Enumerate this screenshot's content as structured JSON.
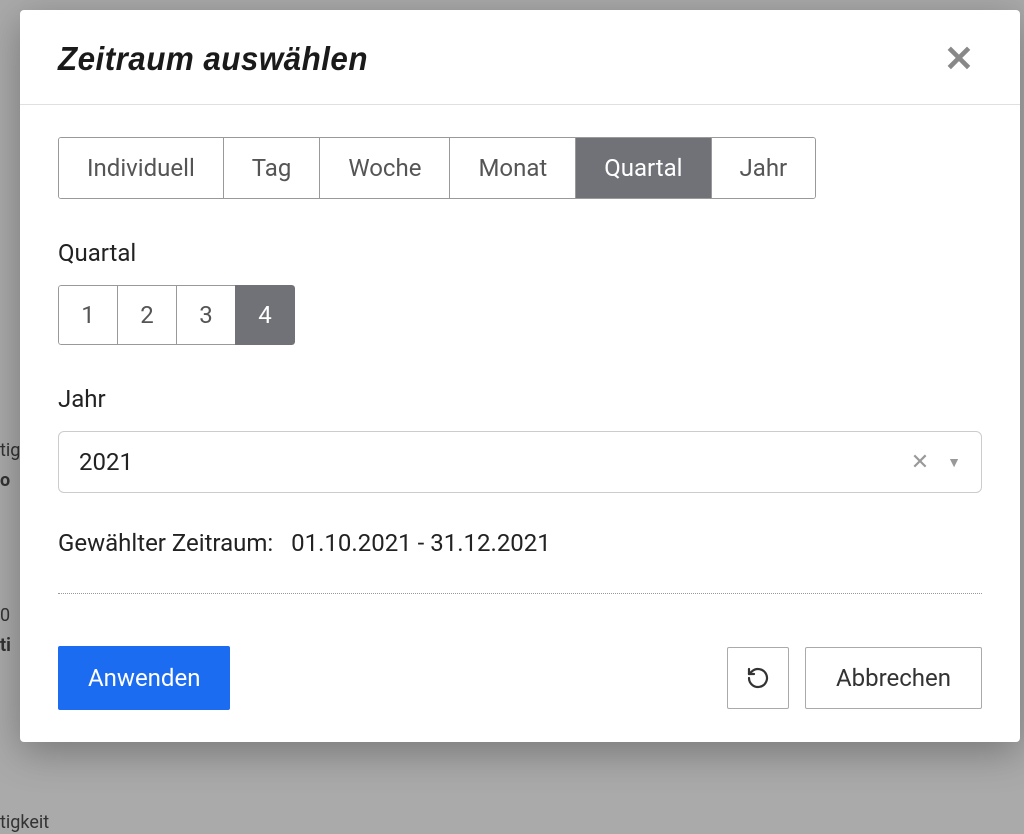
{
  "modal": {
    "title": "Zeitraum auswählen",
    "close_symbol": "✕"
  },
  "tabs": {
    "individual": "Individuell",
    "day": "Tag",
    "week": "Woche",
    "month": "Monat",
    "quarter": "Quartal",
    "year": "Jahr",
    "active": "quarter"
  },
  "quarter": {
    "label": "Quartal",
    "options": [
      "1",
      "2",
      "3",
      "4"
    ],
    "active": "4"
  },
  "year": {
    "label": "Jahr",
    "value": "2021"
  },
  "selected_range": {
    "label": "Gewählter Zeitraum:",
    "value": "01.10.2021 - 31.12.2021"
  },
  "footer": {
    "apply": "Anwenden",
    "cancel": "Abbrechen"
  },
  "background_fragments": {
    "f1": "tig",
    "f2": "o",
    "f3": "0",
    "f4": "ti",
    "f5": "tigkeit"
  }
}
